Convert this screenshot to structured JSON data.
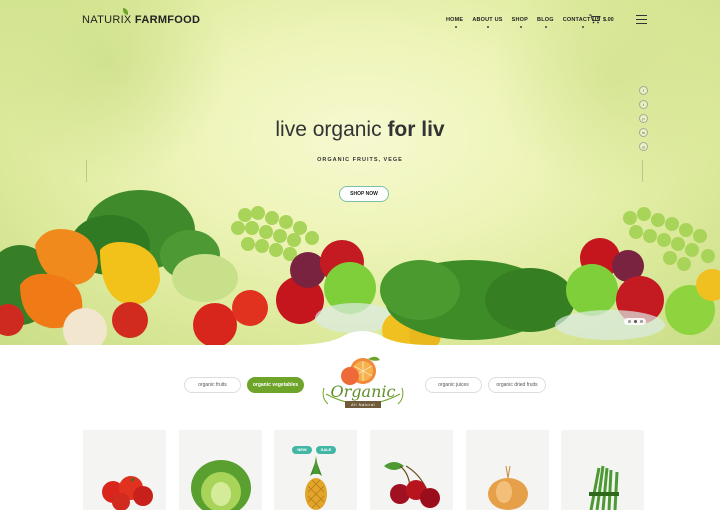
{
  "brand": {
    "logo_thin": "NATURIX ",
    "logo_bold": "FARMFOOD"
  },
  "nav": {
    "items": [
      "HOME",
      "ABOUT US",
      "SHOP",
      "BLOG",
      "CONTACT US"
    ]
  },
  "cart": {
    "total": "$.00"
  },
  "hero": {
    "title_plain": "live organic ",
    "title_bold": "for liv",
    "subtitle": "ORGANIC FRUITS, VEGE",
    "cta_label": "SHOP NOW"
  },
  "social": [
    "f",
    "t",
    "p",
    "in",
    "g"
  ],
  "categories": [
    {
      "label": "organic fruits",
      "active": false
    },
    {
      "label": "organic vegetables",
      "active": true
    },
    {
      "label": "organic juices",
      "active": false
    },
    {
      "label": "organic dried fruits",
      "active": false
    }
  ],
  "emblem": {
    "title": "Organic",
    "ribbon": "All Natural"
  },
  "badges": {
    "new": "NEW",
    "sale": "SALE"
  },
  "products": [
    "tomato",
    "cabbage",
    "pineapple",
    "cherry",
    "onion",
    "asparagus"
  ],
  "colors": {
    "accent": "#6fa42b",
    "button_border": "#7cc0a8",
    "card_bg": "#f4f4f2",
    "badge_new": "#43b7a5",
    "badge_sale": "#43b7a5"
  }
}
